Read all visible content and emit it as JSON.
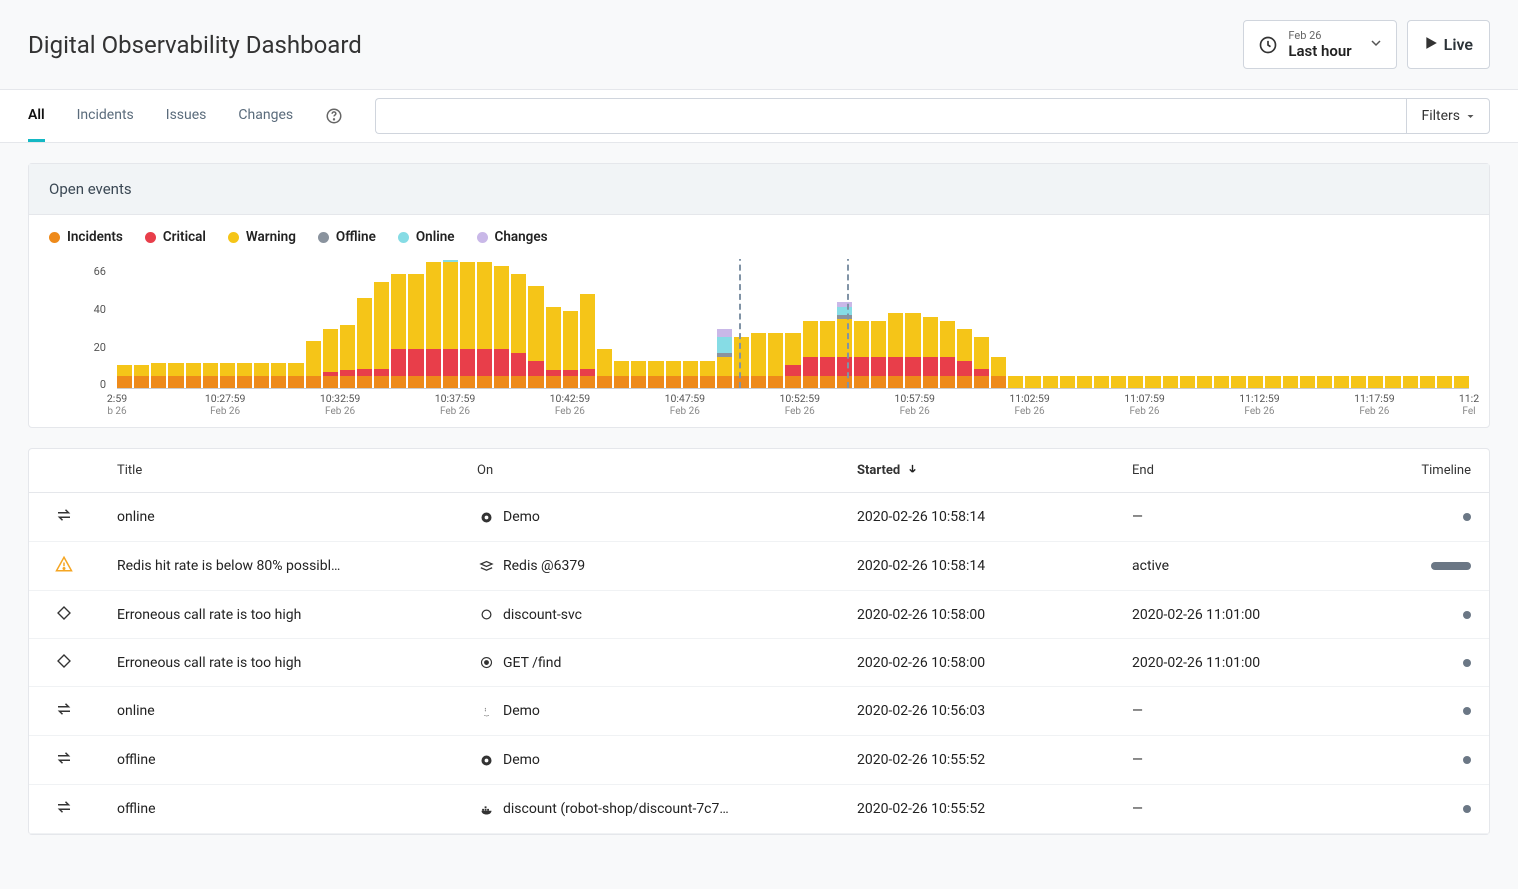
{
  "header": {
    "title": "Digital Observability Dashboard",
    "time_date": "Feb 26",
    "time_label": "Last hour",
    "live_label": "Live"
  },
  "nav": {
    "tabs": [
      {
        "label": "All",
        "active": true
      },
      {
        "label": "Incidents",
        "active": false
      },
      {
        "label": "Issues",
        "active": false
      },
      {
        "label": "Changes",
        "active": false
      }
    ],
    "search_value": "",
    "filters_label": "Filters"
  },
  "chart_panel": {
    "title": "Open events",
    "legend": [
      {
        "label": "Incidents",
        "color": "#ee8a1a"
      },
      {
        "label": "Critical",
        "color": "#e83e4a"
      },
      {
        "label": "Warning",
        "color": "#f5c518"
      },
      {
        "label": "Offline",
        "color": "#8a939e"
      },
      {
        "label": "Online",
        "color": "#86dce5"
      },
      {
        "label": "Changes",
        "color": "#c9b8e8"
      }
    ]
  },
  "chart_data": {
    "type": "bar",
    "ylim": [
      0,
      66
    ],
    "yticks": [
      0,
      20,
      40,
      66
    ],
    "xticks": [
      {
        "pos": 0,
        "label": "2:59",
        "sub": "b 26"
      },
      {
        "pos": 8,
        "label": "10:27:59",
        "sub": "Feb 26"
      },
      {
        "pos": 16.5,
        "label": "10:32:59",
        "sub": "Feb 26"
      },
      {
        "pos": 25,
        "label": "10:37:59",
        "sub": "Feb 26"
      },
      {
        "pos": 33.5,
        "label": "10:42:59",
        "sub": "Feb 26"
      },
      {
        "pos": 42,
        "label": "10:47:59",
        "sub": "Feb 26"
      },
      {
        "pos": 50.5,
        "label": "10:52:59",
        "sub": "Feb 26"
      },
      {
        "pos": 59,
        "label": "10:57:59",
        "sub": "Feb 26"
      },
      {
        "pos": 67.5,
        "label": "11:02:59",
        "sub": "Feb 26"
      },
      {
        "pos": 76,
        "label": "11:07:59",
        "sub": "Feb 26"
      },
      {
        "pos": 84.5,
        "label": "11:12:59",
        "sub": "Feb 26"
      },
      {
        "pos": 93,
        "label": "11:17:59",
        "sub": "Feb 26"
      },
      {
        "pos": 100,
        "label": "11:2",
        "sub": "Fel"
      }
    ],
    "markers": [
      46,
      54
    ],
    "series_colors": {
      "incidents": "#ee8a1a",
      "critical": "#e83e4a",
      "warning": "#f5c518",
      "offline": "#8a939e",
      "online": "#86dce5",
      "changes": "#c9b8e8"
    },
    "bars": [
      {
        "incidents": 6,
        "critical": 0,
        "warning": 6,
        "offline": 0,
        "online": 0,
        "changes": 0
      },
      {
        "incidents": 6,
        "critical": 0,
        "warning": 6,
        "offline": 0,
        "online": 0,
        "changes": 0
      },
      {
        "incidents": 6,
        "critical": 0,
        "warning": 7,
        "offline": 0,
        "online": 0,
        "changes": 0
      },
      {
        "incidents": 6,
        "critical": 0,
        "warning": 7,
        "offline": 0,
        "online": 0,
        "changes": 0
      },
      {
        "incidents": 6,
        "critical": 0,
        "warning": 7,
        "offline": 0,
        "online": 0,
        "changes": 0
      },
      {
        "incidents": 6,
        "critical": 0,
        "warning": 7,
        "offline": 0,
        "online": 0,
        "changes": 0
      },
      {
        "incidents": 6,
        "critical": 0,
        "warning": 7,
        "offline": 0,
        "online": 0,
        "changes": 0
      },
      {
        "incidents": 6,
        "critical": 0,
        "warning": 7,
        "offline": 0,
        "online": 0,
        "changes": 0
      },
      {
        "incidents": 6,
        "critical": 0,
        "warning": 7,
        "offline": 0,
        "online": 0,
        "changes": 0
      },
      {
        "incidents": 6,
        "critical": 0,
        "warning": 7,
        "offline": 0,
        "online": 0,
        "changes": 0
      },
      {
        "incidents": 6,
        "critical": 0,
        "warning": 7,
        "offline": 0,
        "online": 0,
        "changes": 0
      },
      {
        "incidents": 6,
        "critical": 0,
        "warning": 18,
        "offline": 0,
        "online": 0,
        "changes": 0
      },
      {
        "incidents": 6,
        "critical": 2,
        "warning": 22,
        "offline": 0,
        "online": 0,
        "changes": 0
      },
      {
        "incidents": 6,
        "critical": 3,
        "warning": 23,
        "offline": 0,
        "online": 0,
        "changes": 0
      },
      {
        "incidents": 6,
        "critical": 4,
        "warning": 36,
        "offline": 0,
        "online": 0,
        "changes": 0
      },
      {
        "incidents": 6,
        "critical": 4,
        "warning": 44,
        "offline": 0,
        "online": 0,
        "changes": 0
      },
      {
        "incidents": 6,
        "critical": 14,
        "warning": 38,
        "offline": 0,
        "online": 0,
        "changes": 0
      },
      {
        "incidents": 6,
        "critical": 14,
        "warning": 38,
        "offline": 0,
        "online": 0,
        "changes": 0
      },
      {
        "incidents": 6,
        "critical": 14,
        "warning": 44,
        "offline": 0,
        "online": 0,
        "changes": 0
      },
      {
        "incidents": 6,
        "critical": 14,
        "warning": 44,
        "offline": 0,
        "online": 1,
        "changes": 0
      },
      {
        "incidents": 6,
        "critical": 14,
        "warning": 44,
        "offline": 0,
        "online": 0,
        "changes": 0
      },
      {
        "incidents": 6,
        "critical": 14,
        "warning": 44,
        "offline": 0,
        "online": 0,
        "changes": 0
      },
      {
        "incidents": 6,
        "critical": 14,
        "warning": 42,
        "offline": 0,
        "online": 0,
        "changes": 0
      },
      {
        "incidents": 6,
        "critical": 12,
        "warning": 40,
        "offline": 0,
        "online": 0,
        "changes": 0
      },
      {
        "incidents": 6,
        "critical": 8,
        "warning": 38,
        "offline": 0,
        "online": 0,
        "changes": 0
      },
      {
        "incidents": 6,
        "critical": 3,
        "warning": 32,
        "offline": 0,
        "online": 0,
        "changes": 0
      },
      {
        "incidents": 6,
        "critical": 3,
        "warning": 30,
        "offline": 0,
        "online": 0,
        "changes": 0
      },
      {
        "incidents": 6,
        "critical": 4,
        "warning": 38,
        "offline": 0,
        "online": 0,
        "changes": 0
      },
      {
        "incidents": 6,
        "critical": 0,
        "warning": 14,
        "offline": 0,
        "online": 0,
        "changes": 0
      },
      {
        "incidents": 6,
        "critical": 0,
        "warning": 8,
        "offline": 0,
        "online": 0,
        "changes": 0
      },
      {
        "incidents": 6,
        "critical": 0,
        "warning": 8,
        "offline": 0,
        "online": 0,
        "changes": 0
      },
      {
        "incidents": 6,
        "critical": 0,
        "warning": 8,
        "offline": 0,
        "online": 0,
        "changes": 0
      },
      {
        "incidents": 6,
        "critical": 0,
        "warning": 8,
        "offline": 0,
        "online": 0,
        "changes": 0
      },
      {
        "incidents": 6,
        "critical": 0,
        "warning": 8,
        "offline": 0,
        "online": 0,
        "changes": 0
      },
      {
        "incidents": 6,
        "critical": 0,
        "warning": 8,
        "offline": 0,
        "online": 0,
        "changes": 0
      },
      {
        "incidents": 6,
        "critical": 0,
        "warning": 10,
        "offline": 2,
        "online": 8,
        "changes": 4
      },
      {
        "incidents": 6,
        "critical": 0,
        "warning": 20,
        "offline": 0,
        "online": 0,
        "changes": 0
      },
      {
        "incidents": 6,
        "critical": 0,
        "warning": 22,
        "offline": 0,
        "online": 0,
        "changes": 0
      },
      {
        "incidents": 6,
        "critical": 0,
        "warning": 22,
        "offline": 0,
        "online": 0,
        "changes": 0
      },
      {
        "incidents": 6,
        "critical": 6,
        "warning": 16,
        "offline": 0,
        "online": 0,
        "changes": 0
      },
      {
        "incidents": 6,
        "critical": 10,
        "warning": 18,
        "offline": 0,
        "online": 0,
        "changes": 0
      },
      {
        "incidents": 6,
        "critical": 10,
        "warning": 18,
        "offline": 0,
        "online": 0,
        "changes": 0
      },
      {
        "incidents": 6,
        "critical": 10,
        "warning": 19,
        "offline": 2,
        "online": 4,
        "changes": 3
      },
      {
        "incidents": 6,
        "critical": 10,
        "warning": 18,
        "offline": 0,
        "online": 0,
        "changes": 0
      },
      {
        "incidents": 6,
        "critical": 10,
        "warning": 18,
        "offline": 0,
        "online": 0,
        "changes": 0
      },
      {
        "incidents": 6,
        "critical": 10,
        "warning": 22,
        "offline": 0,
        "online": 0,
        "changes": 0
      },
      {
        "incidents": 6,
        "critical": 10,
        "warning": 22,
        "offline": 0,
        "online": 0,
        "changes": 0
      },
      {
        "incidents": 6,
        "critical": 10,
        "warning": 20,
        "offline": 0,
        "online": 0,
        "changes": 0
      },
      {
        "incidents": 6,
        "critical": 10,
        "warning": 18,
        "offline": 0,
        "online": 0,
        "changes": 0
      },
      {
        "incidents": 6,
        "critical": 8,
        "warning": 16,
        "offline": 0,
        "online": 0,
        "changes": 0
      },
      {
        "incidents": 6,
        "critical": 4,
        "warning": 16,
        "offline": 0,
        "online": 0,
        "changes": 0
      },
      {
        "incidents": 6,
        "critical": 0,
        "warning": 10,
        "offline": 0,
        "online": 0,
        "changes": 0
      },
      {
        "incidents": 0,
        "critical": 0,
        "warning": 6,
        "offline": 0,
        "online": 0,
        "changes": 0
      },
      {
        "incidents": 0,
        "critical": 0,
        "warning": 6,
        "offline": 0,
        "online": 0,
        "changes": 0
      },
      {
        "incidents": 0,
        "critical": 0,
        "warning": 6,
        "offline": 0,
        "online": 0,
        "changes": 0
      },
      {
        "incidents": 0,
        "critical": 0,
        "warning": 6,
        "offline": 0,
        "online": 0,
        "changes": 0
      },
      {
        "incidents": 0,
        "critical": 0,
        "warning": 6,
        "offline": 0,
        "online": 0,
        "changes": 0
      },
      {
        "incidents": 0,
        "critical": 0,
        "warning": 6,
        "offline": 0,
        "online": 0,
        "changes": 0
      },
      {
        "incidents": 0,
        "critical": 0,
        "warning": 6,
        "offline": 0,
        "online": 0,
        "changes": 0
      },
      {
        "incidents": 0,
        "critical": 0,
        "warning": 6,
        "offline": 0,
        "online": 0,
        "changes": 0
      },
      {
        "incidents": 0,
        "critical": 0,
        "warning": 6,
        "offline": 0,
        "online": 0,
        "changes": 0
      },
      {
        "incidents": 0,
        "critical": 0,
        "warning": 6,
        "offline": 0,
        "online": 0,
        "changes": 0
      },
      {
        "incidents": 0,
        "critical": 0,
        "warning": 6,
        "offline": 0,
        "online": 0,
        "changes": 0
      },
      {
        "incidents": 0,
        "critical": 0,
        "warning": 6,
        "offline": 0,
        "online": 0,
        "changes": 0
      },
      {
        "incidents": 0,
        "critical": 0,
        "warning": 6,
        "offline": 0,
        "online": 0,
        "changes": 0
      },
      {
        "incidents": 0,
        "critical": 0,
        "warning": 6,
        "offline": 0,
        "online": 0,
        "changes": 0
      },
      {
        "incidents": 0,
        "critical": 0,
        "warning": 6,
        "offline": 0,
        "online": 0,
        "changes": 0
      },
      {
        "incidents": 0,
        "critical": 0,
        "warning": 6,
        "offline": 0,
        "online": 0,
        "changes": 0
      },
      {
        "incidents": 0,
        "critical": 0,
        "warning": 6,
        "offline": 0,
        "online": 0,
        "changes": 0
      },
      {
        "incidents": 0,
        "critical": 0,
        "warning": 6,
        "offline": 0,
        "online": 0,
        "changes": 0
      },
      {
        "incidents": 0,
        "critical": 0,
        "warning": 6,
        "offline": 0,
        "online": 0,
        "changes": 0
      },
      {
        "incidents": 0,
        "critical": 0,
        "warning": 6,
        "offline": 0,
        "online": 0,
        "changes": 0
      },
      {
        "incidents": 0,
        "critical": 0,
        "warning": 6,
        "offline": 0,
        "online": 0,
        "changes": 0
      },
      {
        "incidents": 0,
        "critical": 0,
        "warning": 6,
        "offline": 0,
        "online": 0,
        "changes": 0
      },
      {
        "incidents": 0,
        "critical": 0,
        "warning": 6,
        "offline": 0,
        "online": 0,
        "changes": 0
      },
      {
        "incidents": 0,
        "critical": 0,
        "warning": 6,
        "offline": 0,
        "online": 0,
        "changes": 0
      },
      {
        "incidents": 0,
        "critical": 0,
        "warning": 6,
        "offline": 0,
        "online": 0,
        "changes": 0
      },
      {
        "incidents": 0,
        "critical": 0,
        "warning": 6,
        "offline": 0,
        "online": 0,
        "changes": 0
      },
      {
        "incidents": 0,
        "critical": 0,
        "warning": 6,
        "offline": 0,
        "online": 0,
        "changes": 0
      }
    ]
  },
  "table": {
    "columns": {
      "title": "Title",
      "on": "On",
      "started": "Started",
      "end": "End",
      "timeline": "Timeline"
    },
    "rows": [
      {
        "icon": "swap",
        "title": "online",
        "on_icon": "perspective",
        "on": "Demo",
        "started": "2020-02-26 10:58:14",
        "end": "—",
        "timeline": "dot"
      },
      {
        "icon": "warning",
        "title": "Redis hit rate is below 80% possibl…",
        "on_icon": "stack",
        "on": "Redis @6379",
        "started": "2020-02-26 10:58:14",
        "end": "active",
        "timeline": "bar"
      },
      {
        "icon": "diamond",
        "title": "Erroneous call rate is too high",
        "on_icon": "ring",
        "on": "discount-svc",
        "started": "2020-02-26 10:58:00",
        "end": "2020-02-26 11:01:00",
        "timeline": "dot"
      },
      {
        "icon": "diamond",
        "title": "Erroneous call rate is too high",
        "on_icon": "target",
        "on": "GET /find",
        "started": "2020-02-26 10:58:00",
        "end": "2020-02-26 11:01:00",
        "timeline": "dot"
      },
      {
        "icon": "swap",
        "title": "online",
        "on_icon": "java",
        "on": "Demo",
        "started": "2020-02-26 10:56:03",
        "end": "—",
        "timeline": "dot"
      },
      {
        "icon": "swap",
        "title": "offline",
        "on_icon": "perspective",
        "on": "Demo",
        "started": "2020-02-26 10:55:52",
        "end": "—",
        "timeline": "dot"
      },
      {
        "icon": "swap",
        "title": "offline",
        "on_icon": "docker",
        "on": "discount (robot-shop/discount-7c7…",
        "started": "2020-02-26 10:55:52",
        "end": "—",
        "timeline": "dot"
      }
    ]
  }
}
